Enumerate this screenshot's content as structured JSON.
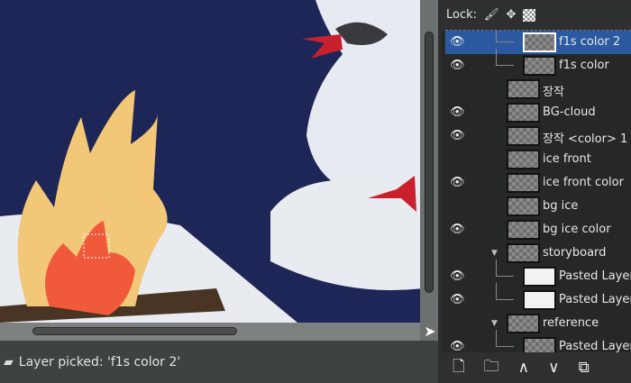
{
  "status": {
    "icon": "layer-stack-icon",
    "message": "Layer picked: 'f1s color 2'"
  },
  "lock": {
    "label": "Lock:",
    "icons": [
      "paintbrush-icon",
      "move-icon",
      "alpha-checker-icon"
    ]
  },
  "layers": [
    {
      "name": "f1s color 2",
      "visible": true,
      "selected": true,
      "depth": 2
    },
    {
      "name": "f1s color",
      "visible": true,
      "depth": 2
    },
    {
      "name": "장작",
      "visible": false,
      "depth": 1
    },
    {
      "name": "BG-cloud",
      "visible": true,
      "depth": 1
    },
    {
      "name": "장작 <color> 1",
      "visible": true,
      "depth": 1
    },
    {
      "name": "ice front",
      "visible": false,
      "depth": 1
    },
    {
      "name": "ice front color",
      "visible": true,
      "depth": 1
    },
    {
      "name": "bg ice",
      "visible": false,
      "depth": 1
    },
    {
      "name": "bg ice color",
      "visible": true,
      "depth": 1
    },
    {
      "name": "storyboard",
      "visible": false,
      "depth": 1,
      "group": true
    },
    {
      "name": "Pasted Layer",
      "visible": true,
      "depth": 2
    },
    {
      "name": "Pasted Layer",
      "visible": true,
      "depth": 2
    },
    {
      "name": "reference",
      "visible": false,
      "depth": 1,
      "group": true
    },
    {
      "name": "Pasted Layer",
      "visible": true,
      "depth": 2
    }
  ],
  "bottom_buttons": [
    "new-layer-icon",
    "new-group-icon",
    "raise-layer-icon",
    "lower-layer-icon",
    "duplicate-layer-icon"
  ]
}
